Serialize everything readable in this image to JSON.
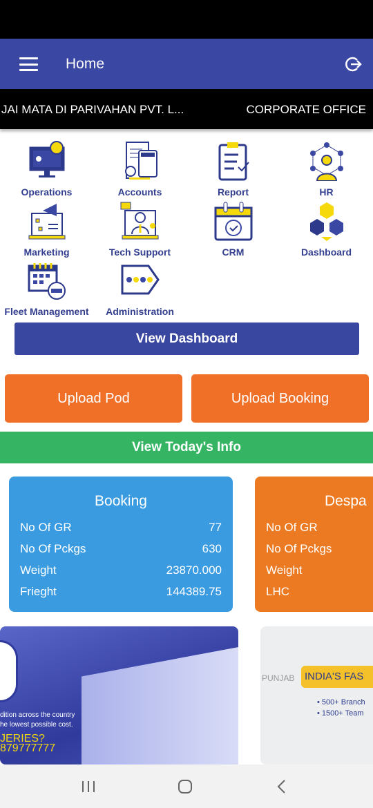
{
  "header": {
    "title": "Home",
    "menu_icon": "hamburger-icon",
    "logout_icon": "logout-icon"
  },
  "company": {
    "name": "JAI MATA DI PARIVAHAN PVT. L...",
    "office": "CORPORATE OFFICE"
  },
  "modules": [
    {
      "label": "Operations",
      "icon": "monitor-gear-icon"
    },
    {
      "label": "Accounts",
      "icon": "calculator-invoice-icon"
    },
    {
      "label": "Report",
      "icon": "clipboard-check-icon"
    },
    {
      "label": "HR",
      "icon": "person-network-icon"
    },
    {
      "label": "Marketing",
      "icon": "megaphone-laptop-icon"
    },
    {
      "label": "Tech Support",
      "icon": "headset-agent-icon"
    },
    {
      "label": "CRM",
      "icon": "calendar-cycle-icon"
    },
    {
      "label": "Dashboard",
      "icon": "cubes-icon"
    },
    {
      "label": "Fleet Management",
      "icon": "calendar-truck-icon"
    },
    {
      "label": "Administration",
      "icon": "tag-dots-icon"
    }
  ],
  "buttons": {
    "view_dashboard": "View Dashboard",
    "upload_pod": "Upload Pod",
    "upload_booking": "Upload Booking",
    "view_today": "View Today's Info"
  },
  "cards": [
    {
      "title": "Booking",
      "color": "#3a9be0",
      "rows": [
        {
          "label": "No Of GR",
          "value": "77"
        },
        {
          "label": "No Of Pckgs",
          "value": "630"
        },
        {
          "label": "Weight",
          "value": "23870.000"
        },
        {
          "label": "Frieght",
          "value": "144389.75"
        }
      ]
    },
    {
      "title": "Despa",
      "color": "#ec7a22",
      "rows": [
        {
          "label": "No Of GR",
          "value": ""
        },
        {
          "label": "No Of Pckgs",
          "value": ""
        },
        {
          "label": "Weight",
          "value": ""
        },
        {
          "label": "LHC",
          "value": ""
        }
      ]
    }
  ],
  "banners": [
    {
      "lines": [
        "dition across the country",
        "he lowest possible cost.",
        "JERIES?",
        "879777777"
      ]
    },
    {
      "lines": [
        "PUNJAB",
        "INDIA'S FAS",
        "• 500+ Branch",
        "• 1500+ Team"
      ]
    }
  ],
  "colors": {
    "primary": "#3a47a3",
    "orange": "#f07028",
    "green": "#35b563",
    "yellow": "#f5d90a"
  }
}
